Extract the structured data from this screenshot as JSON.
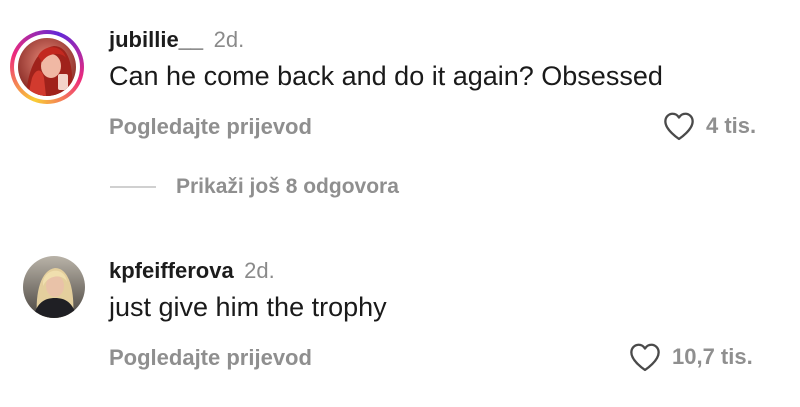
{
  "comments": [
    {
      "username": "jubillie__",
      "time": "2d.",
      "text": "Can he come back and do it again? Obsessed",
      "translate_label": "Pogledajte prijevod",
      "likes": "4 tis.",
      "avatar_icon": "profile-photo-red-hair",
      "has_story_ring": true
    },
    {
      "username": "kpfeifferova",
      "time": "2d.",
      "text": "just give him the trophy",
      "translate_label": "Pogledajte prijevod",
      "likes": "10,7 tis.",
      "avatar_icon": "profile-photo-blonde",
      "has_story_ring": false
    }
  ],
  "replies": {
    "label": "Prikaži još 8 odgovora"
  },
  "colors": {
    "secondary_text": "#8f8f8f",
    "primary_text": "#1a1a1a",
    "story_ring": "#ee2a7b"
  },
  "icons": {
    "like": "heart-outline-icon"
  }
}
